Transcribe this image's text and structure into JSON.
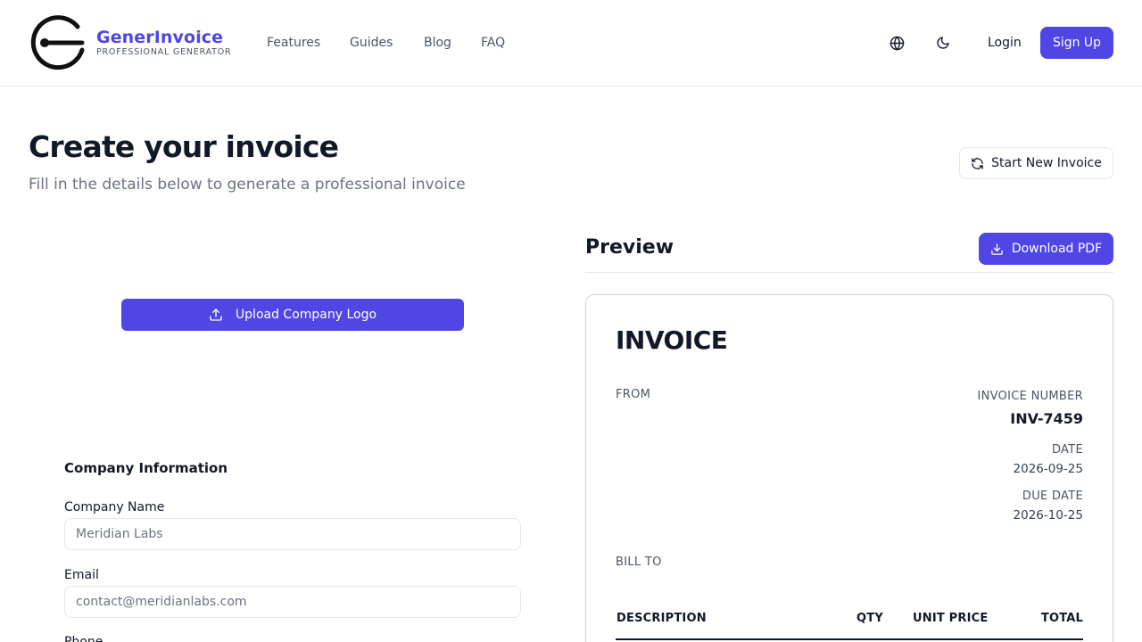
{
  "header": {
    "brand_name": "GenerInvoice",
    "brand_tagline": "PROFESSIONAL GENERATOR",
    "nav": [
      "Features",
      "Guides",
      "Blog",
      "FAQ"
    ],
    "login_label": "Login",
    "signup_label": "Sign Up",
    "icons": [
      "globe-icon",
      "moon-icon"
    ]
  },
  "page": {
    "title": "Create your invoice",
    "subtitle": "Fill in the details below to generate a professional invoice",
    "new_invoice_label": "Start New Invoice"
  },
  "form": {
    "upload_logo_label": "Upload Company Logo",
    "section_title": "Company Information",
    "company_name_label": "Company Name",
    "company_name_placeholder": "Meridian Labs",
    "email_label": "Email",
    "email_placeholder": "contact@meridianlabs.com",
    "phone_label": "Phone"
  },
  "preview": {
    "title": "Preview",
    "download_label": "Download PDF",
    "invoice": {
      "heading": "INVOICE",
      "from_label": "FROM",
      "invoice_number_label": "INVOICE NUMBER",
      "invoice_number": "INV-7459",
      "date_label": "DATE",
      "date": "2026-09-25",
      "due_date_label": "DUE DATE",
      "due_date": "2026-10-25",
      "bill_to_label": "BILL TO",
      "columns": [
        "DESCRIPTION",
        "QTY",
        "UNIT PRICE",
        "TOTAL"
      ]
    }
  },
  "colors": {
    "accent": "#4f46e5",
    "text": "#111827",
    "muted": "#6b7280",
    "border": "#e5e7eb"
  }
}
